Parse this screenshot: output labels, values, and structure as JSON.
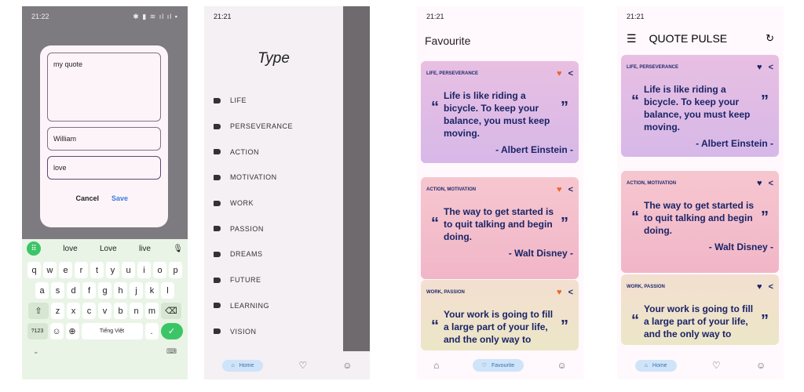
{
  "status": {
    "time1": "21:22",
    "time2": "21:21"
  },
  "dialog": {
    "quote_value": "my quote",
    "author_value": "William",
    "type_value": "love",
    "cancel_label": "Cancel",
    "save_label": "Save"
  },
  "keyboard": {
    "suggestions": [
      "love",
      "Love",
      "live"
    ],
    "row1": [
      "q",
      "w",
      "e",
      "r",
      "t",
      "y",
      "u",
      "i",
      "o",
      "p"
    ],
    "row2": [
      "a",
      "s",
      "d",
      "f",
      "g",
      "h",
      "j",
      "k",
      "l"
    ],
    "row3": [
      "z",
      "x",
      "c",
      "v",
      "b",
      "n",
      "m"
    ],
    "sym_label": "?123",
    "space_label": "Tiếng Việt",
    "period": "."
  },
  "drawer": {
    "title": "Type",
    "items": [
      "LIFE",
      "PERSEVERANCE",
      "ACTION",
      "MOTIVATION",
      "WORK",
      "PASSION",
      "DREAMS",
      "FUTURE",
      "LEARNING",
      "VISION"
    ]
  },
  "nav": {
    "home_label": "Home",
    "favourite_label": "Favourite"
  },
  "favourite": {
    "title": "Favourite"
  },
  "main": {
    "title": "QUOTE PULSE"
  },
  "quotes": [
    {
      "category": "LIFE, PERSEVERANCE",
      "text": "Life is like riding a bicycle. To keep your balance, you must keep moving.",
      "author": "- Albert Einstein -"
    },
    {
      "category": "ACTION, MOTIVATION",
      "text": "The way to get started is to quit talking and begin doing.",
      "author": "- Walt Disney -"
    },
    {
      "category": "WORK, PASSION",
      "text": "Your work is going to fill a large part of your life, and the only way to",
      "author": ""
    }
  ],
  "colors": {
    "accent": "#1a2466",
    "heart_fav": "#e7682a",
    "pill": "#cfe4f8"
  }
}
